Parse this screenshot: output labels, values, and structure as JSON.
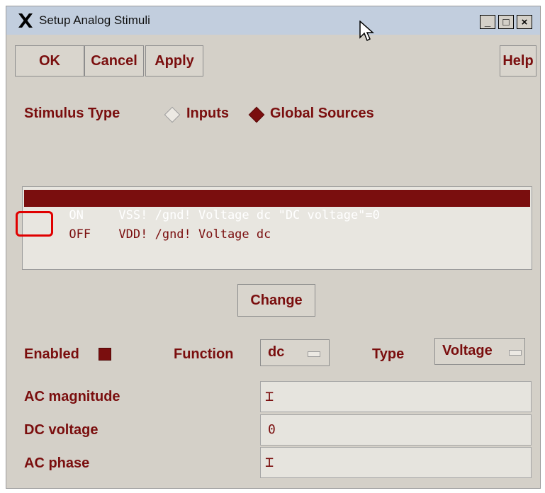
{
  "window": {
    "title": "Setup Analog Stimuli",
    "controls": [
      "_",
      "□",
      "×"
    ]
  },
  "toolbar": {
    "ok_label": "OK",
    "cancel_label": "Cancel",
    "apply_label": "Apply",
    "help_label": "Help"
  },
  "stimulus": {
    "label": "Stimulus Type",
    "options": [
      {
        "label": "Inputs",
        "selected": false
      },
      {
        "label": "Global Sources",
        "selected": true
      }
    ]
  },
  "list": {
    "rows": [
      {
        "state": "ON",
        "text": "VSS! /gnd! Voltage dc \"DC voltage\"=0",
        "selected": true
      },
      {
        "state": "OFF",
        "text": "VDD! /gnd! Voltage dc",
        "selected": false
      }
    ]
  },
  "change_label": "Change",
  "form": {
    "enabled_label": "Enabled",
    "enabled_checked": true,
    "function_label": "Function",
    "function_value": "dc",
    "type_label": "Type",
    "type_value": "Voltage",
    "ac_magnitude_label": "AC magnitude",
    "ac_magnitude_value": "",
    "dc_voltage_label": "DC voltage",
    "dc_voltage_value": "0",
    "ac_phase_label": "AC phase",
    "ac_phase_value": ""
  },
  "colors": {
    "accent": "#7a0e0e",
    "title_bar": "#c2cede",
    "window_bg": "#d4d0c8",
    "highlight": "#e00000"
  }
}
